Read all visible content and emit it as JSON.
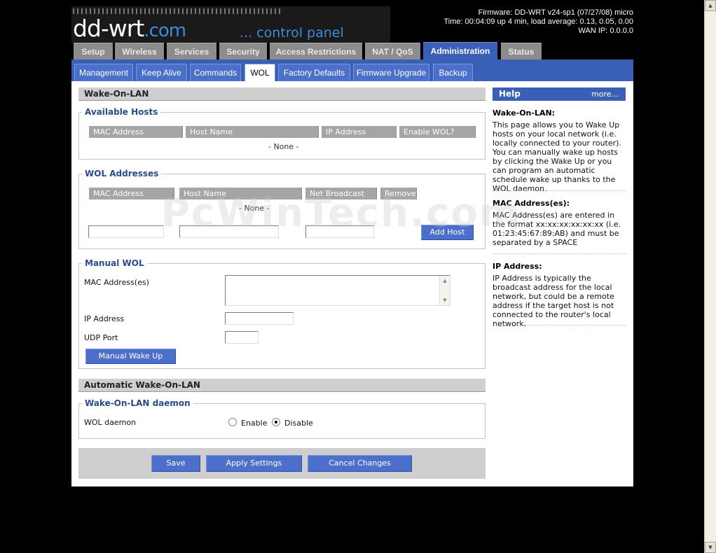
{
  "header": {
    "logo_main": "dd-wrt",
    "logo_dotcom": ".com",
    "logo_sub": "... control panel",
    "firmware": "Firmware: DD-WRT v24-sp1 (07/27/08) micro",
    "time": "Time: 00:04:09 up 4 min, load average: 0.13, 0.05, 0.00",
    "wan_ip": "WAN IP: 0.0.0.0"
  },
  "main_tabs": [
    "Setup",
    "Wireless",
    "Services",
    "Security",
    "Access Restrictions",
    "NAT / QoS",
    "Administration",
    "Status"
  ],
  "sub_tabs": [
    "Management",
    "Keep Alive",
    "Commands",
    "WOL",
    "Factory Defaults",
    "Firmware Upgrade",
    "Backup"
  ],
  "wol": {
    "section_title": "Wake-On-LAN",
    "available_hosts": {
      "legend": "Available Hosts",
      "columns": [
        "MAC Address",
        "Host Name",
        "IP Address",
        "Enable WOL?"
      ],
      "empty": "- None -"
    },
    "wol_addresses": {
      "legend": "WOL Addresses",
      "columns": [
        "MAC Address",
        "Host Name",
        "Net Broadcast",
        "Remove"
      ],
      "empty": "- None -",
      "add_host_label": "Add Host"
    },
    "manual": {
      "legend": "Manual WOL",
      "mac_label": "MAC Address(es)",
      "ip_label": "IP Address",
      "port_label": "UDP Port",
      "wake_label": "Manual Wake Up"
    }
  },
  "auto": {
    "section_title": "Automatic Wake-On-LAN",
    "legend": "Wake-On-LAN daemon",
    "daemon_label": "WOL daemon",
    "enable_label": "Enable",
    "disable_label": "Disable"
  },
  "buttons": {
    "save": "Save",
    "apply": "Apply Settings",
    "cancel": "Cancel Changes"
  },
  "help": {
    "head": "Help",
    "more": "more...",
    "items": [
      {
        "title": "Wake-On-LAN:",
        "text": "This page allows you to Wake Up hosts on your local network (i.e. locally connected to your router). You can manually wake up hosts by clicking the Wake Up or you can program an automatic schedule wake up thanks to the WOL daemon."
      },
      {
        "title": "MAC Address(es):",
        "text": "MAC Address(es) are entered in the format xx:xx:xx:xx:xx:xx (i.e. 01:23:45:67:89:AB) and must be separated by a SPACE"
      },
      {
        "title": "IP Address:",
        "text": "IP Address is typically the broadcast address for the local network, but could be a remote address if the target host is not connected to the router's local network."
      }
    ]
  },
  "watermark": "PcWinTech.com"
}
